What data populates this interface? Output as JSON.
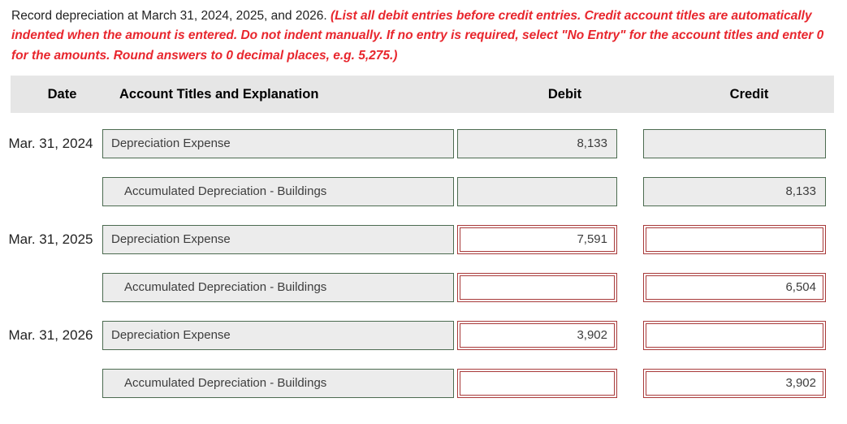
{
  "instructions": {
    "lead": "Record depreciation at March 31, 2024, 2025, and 2026.",
    "note": "(List all debit entries before credit entries. Credit account titles are automatically indented when the amount is entered. Do not indent manually. If no entry is required, select \"No Entry\" for the account titles and enter 0 for the amounts. Round answers to 0 decimal places, e.g. 5,275.)"
  },
  "table": {
    "headers": {
      "date": "Date",
      "account": "Account Titles and Explanation",
      "debit": "Debit",
      "credit": "Credit"
    },
    "rows": [
      {
        "date": "Mar. 31, 2024",
        "account": "Depreciation Expense",
        "indent": false,
        "debit": "8,133",
        "credit": "",
        "account_state": "filled",
        "debit_state": "filled",
        "credit_state": "filled"
      },
      {
        "date": "",
        "account": "Accumulated Depreciation - Buildings",
        "indent": true,
        "debit": "",
        "credit": "8,133",
        "account_state": "filled",
        "debit_state": "filled",
        "credit_state": "filled"
      },
      {
        "date": "Mar. 31, 2025",
        "account": "Depreciation Expense",
        "indent": false,
        "debit": "7,591",
        "credit": "",
        "account_state": "filled",
        "debit_state": "wrong",
        "credit_state": "wrong"
      },
      {
        "date": "",
        "account": "Accumulated Depreciation - Buildings",
        "indent": true,
        "debit": "",
        "credit": "6,504",
        "account_state": "filled",
        "debit_state": "wrong",
        "credit_state": "wrong"
      },
      {
        "date": "Mar. 31, 2026",
        "account": "Depreciation Expense",
        "indent": false,
        "debit": "3,902",
        "credit": "",
        "account_state": "filled",
        "debit_state": "wrong",
        "credit_state": "wrong"
      },
      {
        "date": "",
        "account": "Accumulated Depreciation - Buildings",
        "indent": true,
        "debit": "",
        "credit": "3,902",
        "account_state": "filled",
        "debit_state": "wrong",
        "credit_state": "wrong"
      }
    ]
  },
  "colors": {
    "note_red": "#e8262d",
    "error_border": "#a83a3a",
    "field_border": "#4c6b50",
    "field_fill": "#ececec",
    "header_band": "#e6e6e6"
  }
}
